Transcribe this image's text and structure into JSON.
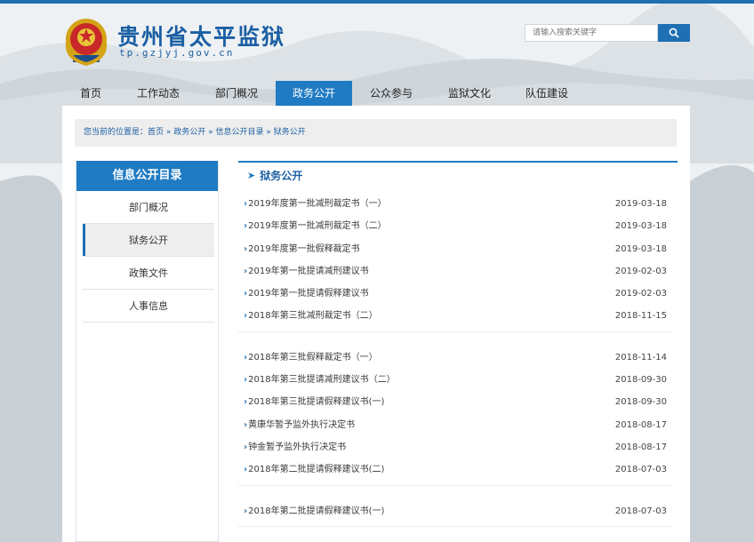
{
  "header": {
    "site_title": "贵州省太平监狱",
    "site_domain": "tp.gzjyj.gov.cn",
    "emblem_icon": "police-emblem-icon"
  },
  "search": {
    "placeholder": "请输入搜索关键字",
    "button_icon": "search-icon"
  },
  "nav": {
    "items": [
      {
        "label": "首页"
      },
      {
        "label": "工作动态"
      },
      {
        "label": "部门概况"
      },
      {
        "label": "政务公开"
      },
      {
        "label": "公众参与"
      },
      {
        "label": "监狱文化"
      },
      {
        "label": "队伍建设"
      }
    ],
    "active": "政务公开"
  },
  "breadcrumb": {
    "text": "您当前的位置是：首页 » 政务公开 » 信息公开目录 » 狱务公开"
  },
  "sidebar": {
    "title": "信息公开目录",
    "items": [
      {
        "label": "部门概况"
      },
      {
        "label": "狱务公开"
      },
      {
        "label": "政策文件"
      },
      {
        "label": "人事信息"
      }
    ],
    "active": "狱务公开"
  },
  "main": {
    "heading": "狱务公开",
    "heading_icon": "arrow-right-icon",
    "groups": [
      [
        {
          "title": "2019年度第一批减刑裁定书（一）",
          "date": "2019-03-18"
        },
        {
          "title": "2019年度第一批减刑裁定书（二）",
          "date": "2019-03-18"
        },
        {
          "title": "2019年度第一批假释裁定书",
          "date": "2019-03-18"
        },
        {
          "title": "2019年第一批提请减刑建议书",
          "date": "2019-02-03"
        },
        {
          "title": "2019年第一批提请假释建议书",
          "date": "2019-02-03"
        },
        {
          "title": "2018年第三批减刑裁定书（二）",
          "date": "2018-11-15"
        }
      ],
      [
        {
          "title": "2018年第三批假释裁定书（一）",
          "date": "2018-11-14"
        },
        {
          "title": "2018年第三批提请减刑建议书（二）",
          "date": "2018-09-30"
        },
        {
          "title": "2018年第三批提请假释建议书(一)",
          "date": "2018-09-30"
        },
        {
          "title": "黄康华暂予监外执行决定书",
          "date": "2018-08-17"
        },
        {
          "title": "钟金暂予监外执行决定书",
          "date": "2018-08-17"
        },
        {
          "title": "2018年第二批提请假释建议书(二)",
          "date": "2018-07-03"
        }
      ],
      [
        {
          "title": "2018年第二批提请假释建议书(一)",
          "date": "2018-07-03"
        }
      ]
    ]
  },
  "colors": {
    "accent": "#1f7bc3",
    "brand_text": "#1b5fa3"
  }
}
